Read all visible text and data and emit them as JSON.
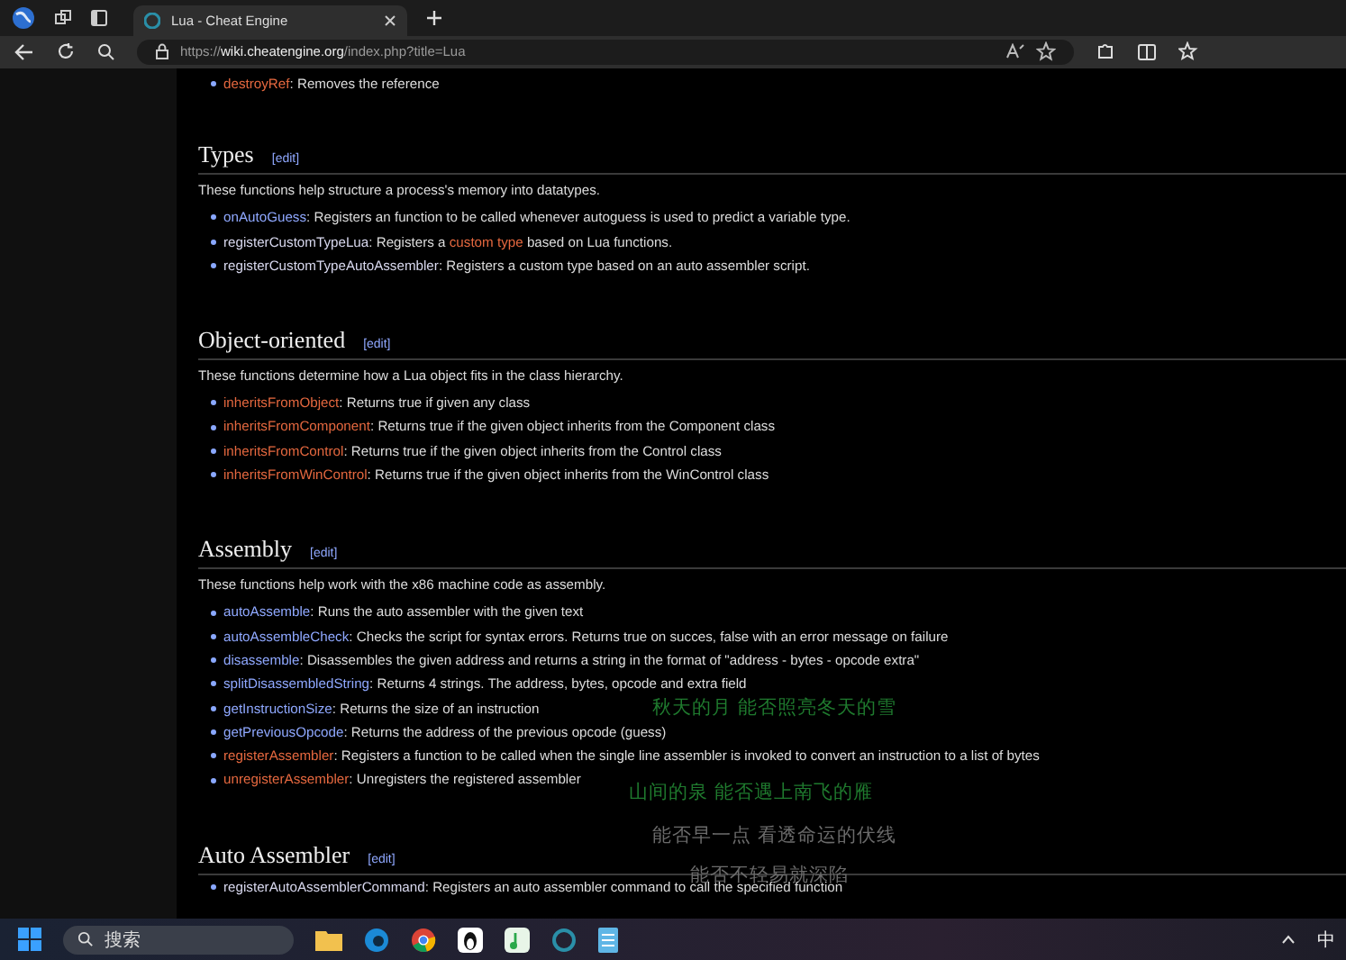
{
  "browser": {
    "tab_title": "Lua - Cheat Engine",
    "url_prefix": "https://",
    "url_domain": "wiki.cheatengine.org",
    "url_path": "/index.php?title=Lua"
  },
  "top_items": [
    {
      "kind": "redlink",
      "name": "destroyRef",
      "desc": [
        {
          "kind": "text",
          "text": ": Removes the reference"
        }
      ]
    }
  ],
  "sections": [
    {
      "title": "Types",
      "edit": "[edit]",
      "intro": "These functions help structure a process's memory into datatypes.",
      "items": [
        {
          "kind": "link",
          "name": "onAutoGuess",
          "desc": [
            {
              "kind": "text",
              "text": ": Registers an function to be called whenever autoguess is used to predict a variable type."
            }
          ]
        },
        {
          "kind": "visited",
          "name": "registerCustomTypeLua",
          "desc": [
            {
              "kind": "text",
              "text": ": Registers a "
            },
            {
              "kind": "redlink",
              "text": "custom type"
            },
            {
              "kind": "text",
              "text": " based on Lua functions."
            }
          ]
        },
        {
          "kind": "visited",
          "name": "registerCustomTypeAutoAssembler",
          "desc": [
            {
              "kind": "text",
              "text": ": Registers a custom type based on an auto assembler script."
            }
          ]
        }
      ]
    },
    {
      "title": "Object-oriented",
      "edit": "[edit]",
      "intro": "These functions determine how a Lua object fits in the class hierarchy.",
      "items": [
        {
          "kind": "redlink",
          "name": "inheritsFromObject",
          "desc": [
            {
              "kind": "text",
              "text": ": Returns true if given any class"
            }
          ]
        },
        {
          "kind": "redlink",
          "name": "inheritsFromComponent",
          "desc": [
            {
              "kind": "text",
              "text": ": Returns true if the given object inherits from the Component class"
            }
          ]
        },
        {
          "kind": "redlink",
          "name": "inheritsFromControl",
          "desc": [
            {
              "kind": "text",
              "text": ": Returns true if the given object inherits from the Control class"
            }
          ]
        },
        {
          "kind": "redlink",
          "name": "inheritsFromWinControl",
          "desc": [
            {
              "kind": "text",
              "text": ": Returns true if the given object inherits from the WinControl class"
            }
          ]
        }
      ]
    },
    {
      "title": "Assembly",
      "edit": "[edit]",
      "intro": "These functions help work with the x86 machine code as assembly.",
      "items": [
        {
          "kind": "link",
          "name": "autoAssemble",
          "desc": [
            {
              "kind": "text",
              "text": ": Runs the auto assembler with the given text"
            }
          ]
        },
        {
          "kind": "link",
          "name": "autoAssembleCheck",
          "desc": [
            {
              "kind": "text",
              "text": ": Checks the script for syntax errors. Returns true on succes, false with an error message on failure"
            }
          ]
        },
        {
          "kind": "link",
          "name": "disassemble",
          "desc": [
            {
              "kind": "text",
              "text": ": Disassembles the given address and returns a string in the format of \"address - bytes - opcode extra\""
            }
          ]
        },
        {
          "kind": "link",
          "name": "splitDisassembledString",
          "desc": [
            {
              "kind": "text",
              "text": ": Returns 4 strings. The address, bytes, opcode and extra field"
            }
          ]
        },
        {
          "kind": "link",
          "name": "getInstructionSize",
          "desc": [
            {
              "kind": "text",
              "text": ": Returns the size of an instruction"
            }
          ]
        },
        {
          "kind": "link",
          "name": "getPreviousOpcode",
          "desc": [
            {
              "kind": "text",
              "text": ": Returns the address of the previous opcode (guess)"
            }
          ]
        },
        {
          "kind": "redlink",
          "name": "registerAssembler",
          "desc": [
            {
              "kind": "text",
              "text": ": Registers a function to be called when the single line assembler is invoked to convert an instruction to a list of bytes"
            }
          ]
        },
        {
          "kind": "redlink",
          "name": "unregisterAssembler",
          "desc": [
            {
              "kind": "text",
              "text": ": Unregisters the registered assembler"
            }
          ]
        }
      ]
    },
    {
      "title": "Auto Assembler",
      "edit": "[edit]",
      "items": [
        {
          "kind": "visited",
          "name": "registerAutoAssemblerCommand",
          "desc": [
            {
              "kind": "text",
              "text": ": Registers an auto assembler command to call the specified function"
            }
          ]
        }
      ]
    }
  ],
  "lyrics": [
    {
      "text": "秋天的月 能否照亮冬天的雪",
      "color": "#1f7a2e"
    },
    {
      "text": "山间的泉 能否遇上南飞的雁",
      "color": "#1f7a2e"
    },
    {
      "text": "能否早一点 看透命运的伏线",
      "color": "#6b6b6b"
    },
    {
      "text": "能否不轻易就深陷",
      "color": "#6b6b6b"
    }
  ],
  "taskbar": {
    "search_placeholder": "搜索",
    "ime": "中"
  }
}
